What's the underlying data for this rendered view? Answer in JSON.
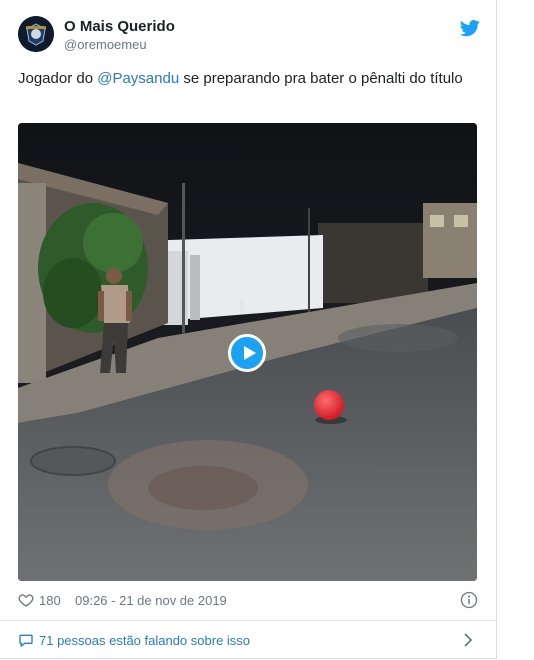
{
  "tweet": {
    "author_name": "O Mais Querido",
    "author_handle": "@oremoemeu",
    "text_before": "Jogador do ",
    "mention": "@Paysandu",
    "text_after": " se preparando pra bater o pênalti do título",
    "likes": "180",
    "timestamp": "09:26 - 21 de nov de 2019",
    "footer_label": "71 pessoas estão falando sobre isso"
  },
  "icons": {
    "brand": "twitter-bird-icon",
    "like": "heart-icon",
    "info": "info-icon",
    "comment": "comment-icon",
    "chevron": "chevron-right-icon",
    "play": "play-icon"
  },
  "colors": {
    "brand_blue": "#1da1f2",
    "link_blue": "#2b7bb9",
    "muted_text": "#697882",
    "primary_text": "#1c2022",
    "ball_red": "#e8323a"
  }
}
